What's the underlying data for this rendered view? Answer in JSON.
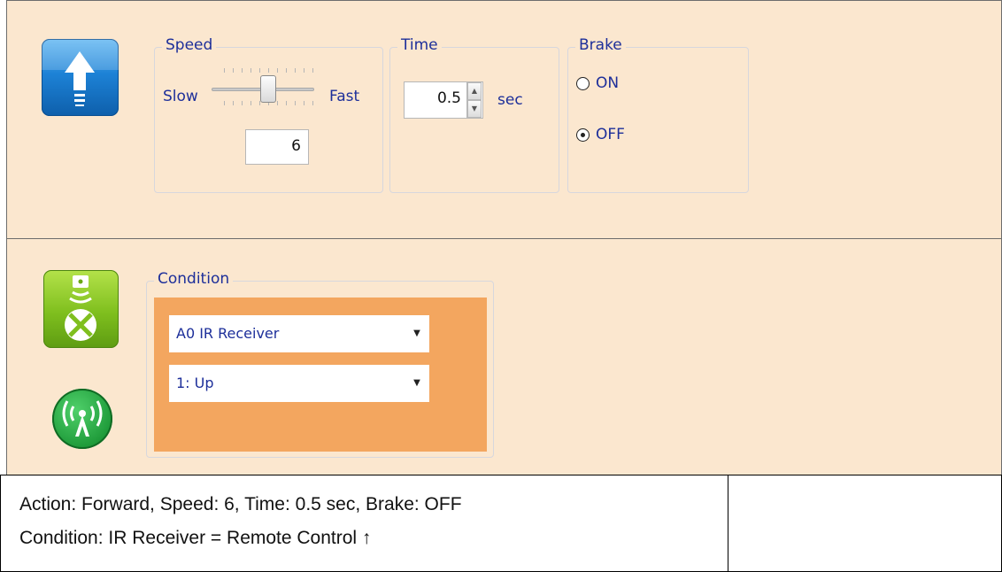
{
  "action_panel": {
    "icon": "arrow-up-icon",
    "speed": {
      "title": "Speed",
      "slow_label": "Slow",
      "fast_label": "Fast",
      "value": "6",
      "slider_level": 6
    },
    "time": {
      "title": "Time",
      "value": "0.5",
      "unit": "sec"
    },
    "brake": {
      "title": "Brake",
      "options": [
        "ON",
        "OFF"
      ],
      "selected": "OFF"
    }
  },
  "condition_panel": {
    "icons": [
      "ir-receiver-icon",
      "wireless-signal-icon"
    ],
    "title": "Condition",
    "sensor_select": "A0 IR Receiver",
    "value_select": "1: Up"
  },
  "description": {
    "line1": "Action: Forward, Speed: 6, Time: 0.5 sec, Brake: OFF",
    "line2": "Condition: IR Receiver = Remote Control ↑"
  }
}
